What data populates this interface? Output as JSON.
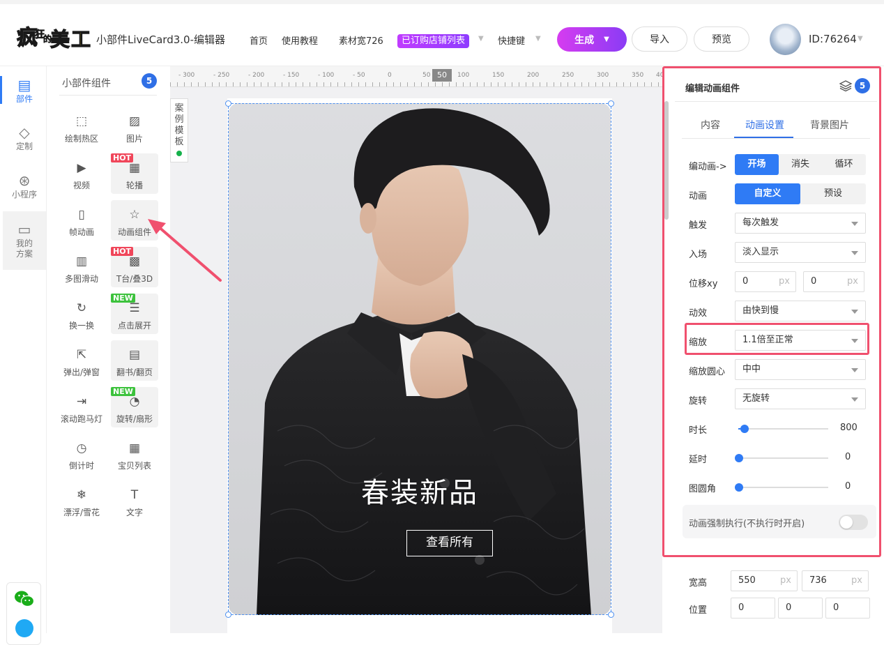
{
  "header": {
    "app_title": "小部件LiveCard3.0-编辑器",
    "nav": [
      "首页",
      "使用教程",
      "素材宽726"
    ],
    "badge": "已订购店铺列表",
    "shortcut": "快捷键",
    "generate": "生成",
    "import": "导入",
    "preview": "预览",
    "user_id": "ID:76264"
  },
  "rail": {
    "items": [
      "部件",
      "定制",
      "小程序",
      "我的方案"
    ]
  },
  "components": {
    "title": "小部件组件",
    "count": "5",
    "items": [
      {
        "label": "绘制热区",
        "icon": "hotspot-icon"
      },
      {
        "label": "图片",
        "icon": "image-icon"
      },
      {
        "label": "视频",
        "icon": "video-icon"
      },
      {
        "label": "轮播",
        "icon": "carousel-icon",
        "tag": "HOT"
      },
      {
        "label": "帧动画",
        "icon": "gif-icon"
      },
      {
        "label": "动画组件",
        "icon": "animation-star-icon"
      },
      {
        "label": "多图滑动",
        "icon": "multi-slide-icon"
      },
      {
        "label": "T台/叠3D",
        "icon": "stage-3d-icon",
        "tag": "HOT"
      },
      {
        "label": "换一换",
        "icon": "refresh-icon"
      },
      {
        "label": "点击展开",
        "icon": "expand-icon",
        "tag": "NEW"
      },
      {
        "label": "弹出/弹窗",
        "icon": "popup-icon"
      },
      {
        "label": "翻书/翻页",
        "icon": "book-icon"
      },
      {
        "label": "滚动跑马灯",
        "icon": "marquee-icon"
      },
      {
        "label": "旋转/扇形",
        "icon": "rotate-icon",
        "tag": "NEW"
      },
      {
        "label": "倒计时",
        "icon": "clock-icon"
      },
      {
        "label": "宝贝列表",
        "icon": "grid-list-icon"
      },
      {
        "label": "漂浮/雪花",
        "icon": "snowflake-icon"
      },
      {
        "label": "文字",
        "icon": "text-icon"
      }
    ]
  },
  "canvas": {
    "ruler_labels": [
      "- 300",
      "- 250",
      "- 200",
      "- 150",
      "- 100",
      "- 50",
      "0",
      "50",
      "100",
      "150",
      "200",
      "250",
      "300",
      "350",
      "40"
    ],
    "ruler_marker": "50",
    "template_tab": "案例模板",
    "headline": "春装新品",
    "view_all": "查看所有"
  },
  "panel": {
    "title": "编辑动画组件",
    "count": "5",
    "tabs": [
      "内容",
      "动画设置",
      "背景图片"
    ],
    "active_tab": "动画设置",
    "edit_anim_label": "编动画->",
    "edit_anim_options": [
      "开场",
      "消失",
      "循环"
    ],
    "anim_label": "动画",
    "anim_options": [
      "自定义",
      "预设"
    ],
    "trigger_label": "触发",
    "trigger_value": "每次触发",
    "enter_label": "入场",
    "enter_value": "淡入显示",
    "offset_label": "位移xy",
    "offset_x": "0",
    "offset_y": "0",
    "unit_px": "px",
    "easing_label": "动效",
    "easing_value": "由快到慢",
    "scale_label": "缩放",
    "scale_value": "1.1倍至正常",
    "origin_label": "缩放圆心",
    "origin_value": "中中",
    "rotate_label": "旋转",
    "rotate_value": "无旋转",
    "duration_label": "时长",
    "duration_value": "800",
    "duration_fraction": 0.06,
    "delay_label": "延时",
    "delay_value": "0",
    "delay_fraction": 0,
    "radius_label": "图圆角",
    "radius_value": "0",
    "radius_fraction": 0,
    "force_label": "动画强制执行(不执行时开启)",
    "size_label": "宽高",
    "width": "550",
    "height": "736",
    "pos_label": "位置",
    "pos_x": "0",
    "pos_y": "0",
    "pos_z": "0"
  },
  "colors": {
    "accent": "#2f7bf5",
    "highlight": "#f0506e",
    "generate_gradient": "#c13cff"
  }
}
